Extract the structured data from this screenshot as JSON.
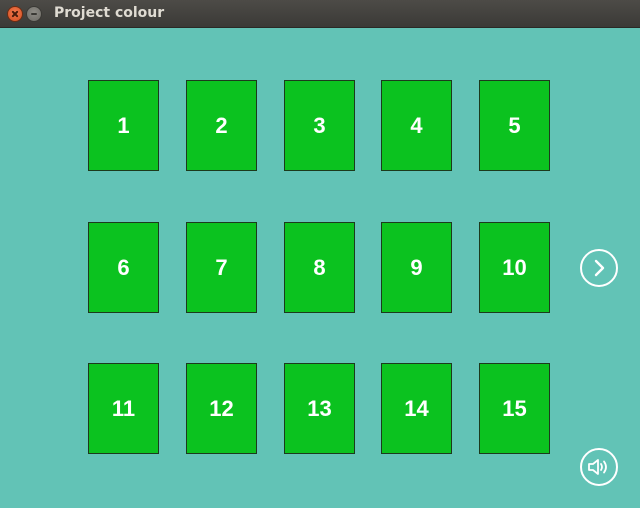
{
  "window": {
    "title": "Project colour"
  },
  "colors": {
    "background": "#62c3b6",
    "tile": "#0bc21f",
    "tile_text": "#ffffff"
  },
  "levels": [
    "1",
    "2",
    "3",
    "4",
    "5",
    "6",
    "7",
    "8",
    "9",
    "10",
    "11",
    "12",
    "13",
    "14",
    "15"
  ],
  "controls": {
    "next_icon": "chevron-right-icon",
    "sound_icon": "speaker-icon"
  }
}
